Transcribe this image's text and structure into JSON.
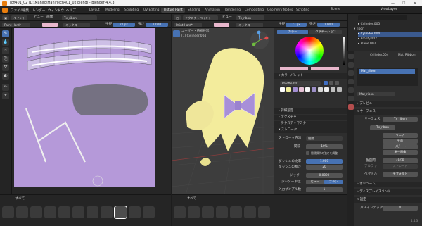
{
  "window": {
    "title": "[ch401_02 [D:\\Mahiro\\Mahiro\\ch401_02.blend] - Blender 4.4.3",
    "minimize": "—",
    "maximize": "☐",
    "close": "✕"
  },
  "menubar": {
    "items": [
      "ファイル",
      "編集",
      "レンダー",
      "ウィンドウ",
      "ヘルプ"
    ],
    "workspaces": [
      "Layout",
      "Modeling",
      "Sculpting",
      "UV Editing",
      "Texture Paint",
      "Shading",
      "Animation",
      "Rendering",
      "Compositing",
      "Geometry Nodes",
      "Scripting"
    ],
    "active_workspace": "Texture Paint",
    "scene": "Scene",
    "view_layer": "ViewLayer"
  },
  "image_editor": {
    "header": {
      "mode": "ペイント",
      "view": "ビュー",
      "image_menu": "画像",
      "texture": "Tx_ribon"
    },
    "tool_header": {
      "brush": "Paint Hard*",
      "blend": "ミックス",
      "radius_label": "半径",
      "radius": "77 px",
      "strength_label": "強さ",
      "strength": "1.000"
    },
    "brushes_tab": "すべて"
  },
  "viewport": {
    "header": {
      "mode": "テクスチャペイント",
      "view": "ビュー",
      "texture": "Tx_ribon"
    },
    "tool_header": {
      "brush": "Paint Hard*",
      "blend": "ミックス",
      "radius_label": "半径",
      "radius": "77 px",
      "strength_label": "強さ",
      "strength": "1.000"
    },
    "overlay_line1": "ユーザー・透視投影",
    "overlay_line2": "(1) Cylinder.004",
    "brushes_tab": "すべて"
  },
  "brush_panel": {
    "tabs": [
      "カラー",
      "グラデーション"
    ],
    "active_tab": "カラー",
    "color_palette_label": "カラーパレット",
    "palette_name": "Palette.001",
    "sections": [
      "詳細設定",
      "テクスチャ",
      "テクスチャマスク",
      "ストローク"
    ],
    "stroke_method_label": "ストローク方法",
    "stroke_method": "間隔",
    "spacing_label": "間隔",
    "spacing": "10%",
    "spacing_option": "間隔保持の強さを調整",
    "dash_ratio_label": "ダッシュの比率",
    "dash_ratio": "1.000",
    "dash_length_label": "ダッシュの長さ",
    "dash_length": "20",
    "jitter_label": "ジッター",
    "jitter": "0.0000",
    "jitter_source_label": "ジッター単位",
    "jitter_view": "ビュー",
    "jitter_brush": "ブラシ",
    "input_samples_label": "入力サンプル数",
    "input_samples": "1",
    "palette_colors": [
      "#ffffff",
      "#f2ef9a",
      "#a38fd3",
      "#e6c1d6",
      "#f7f7f7",
      "#9c8fc7",
      "#d8d8d8",
      "#eeeeee",
      "#c0c0c0",
      "#bcbcbc"
    ]
  },
  "outliner": {
    "search_placeholder": "",
    "items": [
      {
        "name": "Cylinder.005"
      },
      {
        "name": "ribon"
      },
      {
        "name": "Cylinder.004"
      },
      {
        "name": "Empty.002"
      },
      {
        "name": "Plane.002"
      }
    ]
  },
  "properties": {
    "object": "Cylinder.004",
    "material": "Mat_Ribbon",
    "material_slot": "Mat_ribon",
    "material_name": "Mat_ribon",
    "sections": {
      "preview": "プレビュー",
      "surface": "サーフェス",
      "volume": "ボリューム",
      "displacement": "ディスプレイスメント",
      "settings": "設定"
    },
    "surface_label": "サーフェス",
    "surface_value": "Tx_ribon",
    "texture_node": "Tx_ribon",
    "interp": "リニア",
    "projection": "平面",
    "extension": "リピート",
    "alpha": "単一画像",
    "colorspace_label": "色空間",
    "colorspace": "sRGB",
    "alpha_label": "アルファ",
    "alpha_value": "ストレート",
    "vector_label": "ベクトル",
    "vector_value": "デフォルト",
    "pass_index_label": "パスインデックス",
    "pass_index": "0",
    "version": "4.4.3"
  },
  "colors": {
    "accent": "#4772b3",
    "canvas": "#b599d9",
    "hair": "#f3ec9c",
    "ribbon": "#a88fd8"
  }
}
